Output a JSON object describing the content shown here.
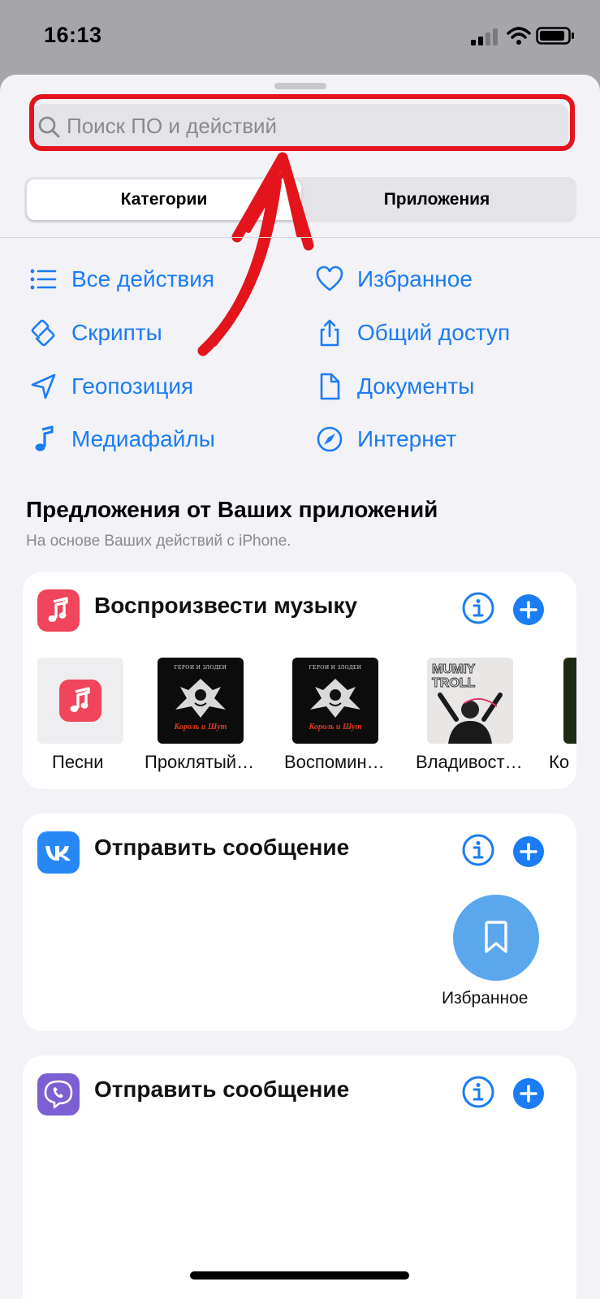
{
  "status": {
    "time": "16:13"
  },
  "search": {
    "placeholder": "Поиск ПО и действий"
  },
  "segments": {
    "categories": "Категории",
    "apps": "Приложения"
  },
  "categories": [
    {
      "label": "Все действия",
      "icon": "list-icon"
    },
    {
      "label": "Избранное",
      "icon": "heart-icon"
    },
    {
      "label": "Скрипты",
      "icon": "scripts-icon"
    },
    {
      "label": "Общий доступ",
      "icon": "share-icon"
    },
    {
      "label": "Геопозиция",
      "icon": "location-arrow-icon"
    },
    {
      "label": "Документы",
      "icon": "document-icon"
    },
    {
      "label": "Медиафайлы",
      "icon": "music-note-icon"
    },
    {
      "label": "Интернет",
      "icon": "compass-icon"
    }
  ],
  "suggestions": {
    "title": "Предложения от Ваших приложений",
    "subtitle": "На основе Ваших действий с iPhone."
  },
  "cards": [
    {
      "title": "Воспроизвести музыку",
      "app": "music",
      "items": [
        "Песни",
        "Проклятый…",
        "Воспомин…",
        "Владивост…",
        "Ко"
      ],
      "album_caption": "ГЕРОИ И ЗЛОДЕИ",
      "album_band": "Король и Шут",
      "album4_text": "MUMIY TROLL"
    },
    {
      "title": "Отправить сообщение",
      "app": "vk",
      "target": "Избранное"
    },
    {
      "title": "Отправить сообщение",
      "app": "viber"
    }
  ],
  "colors": {
    "accent": "#1b7cf4",
    "highlight": "#e3141b",
    "music": "#f0455a",
    "vk": "#2787f5",
    "viber": "#7d5fd4"
  }
}
